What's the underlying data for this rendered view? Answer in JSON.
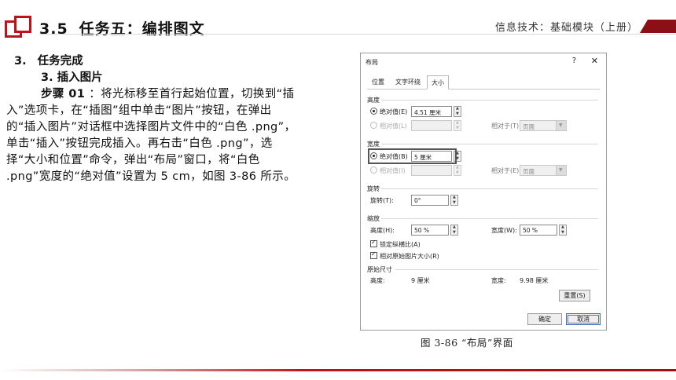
{
  "header": {
    "section_number": "3.5",
    "section_title": "任务五：编排图文",
    "course_tag": "信息技术：基础模块（上册）"
  },
  "content": {
    "heading_index": "3.",
    "heading": "任务完成",
    "subheading": "3. 插入图片",
    "step_label": "步骤 01",
    "paragraph": " ：将光标移至首行起始位置，切换到“插入”选项卡，在“插图”组中单击“图片”按钮，在弹出的“插入图片”对话框中选择图片文件中的“白色 .png”，单击“插入”按钮完成插入。再右击“白色 .png”，选择“大小和位置”命令，弹出“布局”窗口，将“白色 .png”宽度的“绝对值”设置为 5 cm，如图 3-86 所示。"
  },
  "dialog": {
    "title": "布局",
    "help_glyph": "?",
    "close_glyph": "✕",
    "tabs": [
      "位置",
      "文字环绕",
      "大小"
    ],
    "active_tab": "大小",
    "height_group": {
      "label": "高度",
      "absolute_label": "绝对值(E)",
      "absolute_value": "4.51 厘米",
      "relative_label": "相对值(L)",
      "relative_to_label": "相对于(T)",
      "relative_to_value": "页面"
    },
    "width_group": {
      "label": "宽度",
      "absolute_label": "绝对值(B)",
      "absolute_value": "5 厘米",
      "relative_label": "相对值(I)",
      "relative_to_label": "相对于(E)",
      "relative_to_value": "页面"
    },
    "rotate_group": {
      "label": "旋转",
      "rotation_label": "旋转(T):",
      "rotation_value": "0°"
    },
    "scale_group": {
      "label": "缩放",
      "height_label": "高度(H):",
      "height_value": "50 %",
      "width_label": "宽度(W):",
      "width_value": "50 %",
      "lock_aspect_label": "锁定纵横比(A)",
      "relative_original_label": "相对原始图片大小(R)"
    },
    "original_group": {
      "label": "原始尺寸",
      "height_label": "高度:",
      "height_value": "9 厘米",
      "width_label": "宽度:",
      "width_value": "9.98 厘米"
    },
    "reset_label": "重置(S)",
    "ok_label": "确定",
    "cancel_label": "取消"
  },
  "caption": "图 3-86 “布局”界面",
  "colors": {
    "accent_red": "#c0121b",
    "dark_red": "#8b0f14"
  }
}
